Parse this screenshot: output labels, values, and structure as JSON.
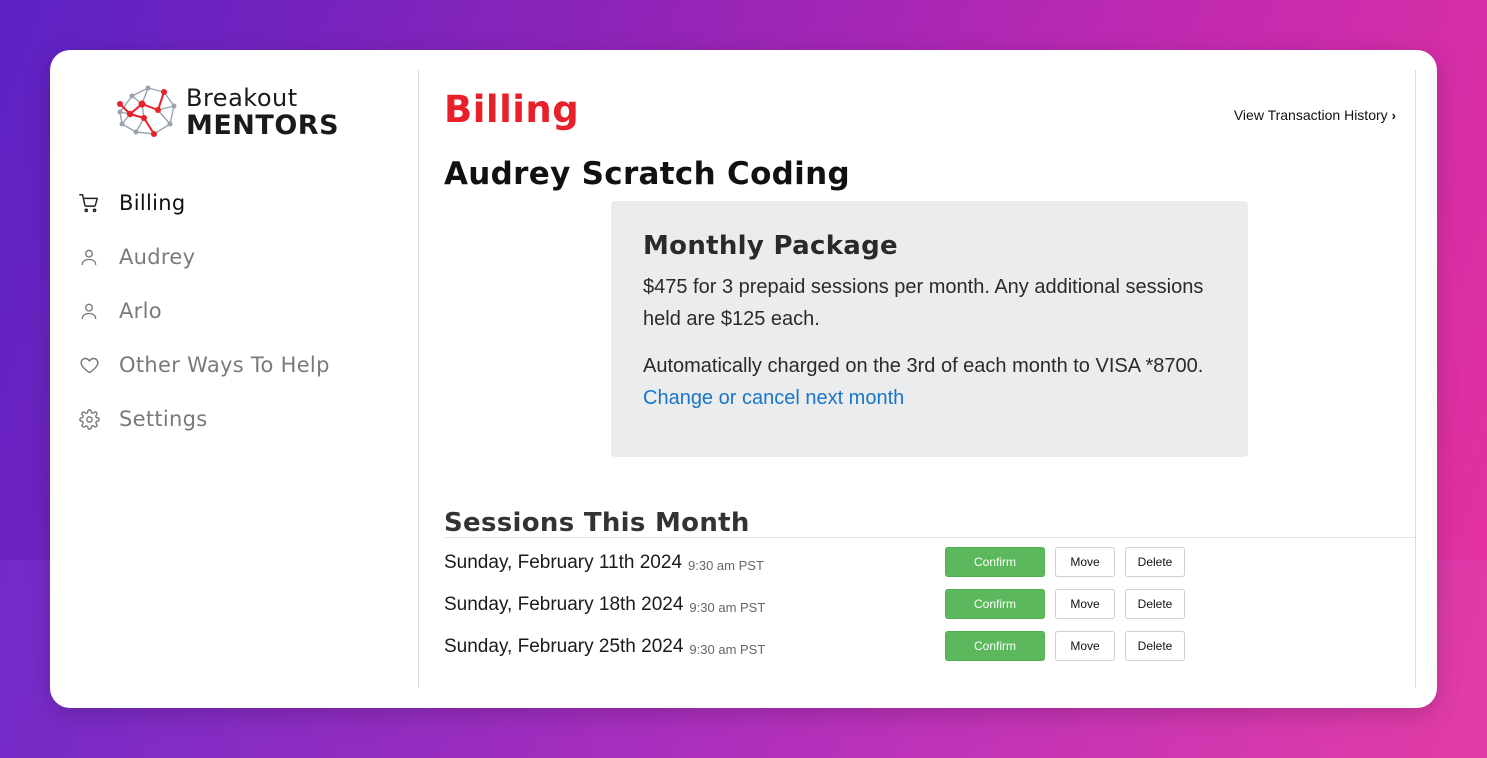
{
  "brand": {
    "line1": "Breakout",
    "line2": "MENTORS",
    "accent_color": "#e8202a",
    "node_color": "#9aa3ad"
  },
  "sidebar": {
    "items": [
      {
        "label": "Billing",
        "icon": "cart-icon",
        "active": true
      },
      {
        "label": "Audrey",
        "icon": "user-icon",
        "active": false
      },
      {
        "label": "Arlo",
        "icon": "user-icon",
        "active": false
      },
      {
        "label": "Other Ways To Help",
        "icon": "heart-icon",
        "active": false
      },
      {
        "label": "Settings",
        "icon": "gear-icon",
        "active": false
      }
    ]
  },
  "header": {
    "title": "Billing",
    "history_link": "View Transaction History"
  },
  "student": {
    "title": "Audrey Scratch Coding"
  },
  "package": {
    "title": "Monthly Package",
    "description": "$475 for 3 prepaid sessions per month. Any additional sessions held are $125 each.",
    "charge_text": "Automatically charged on the 3rd of each month to VISA *8700.",
    "change_link": "Change or cancel next month"
  },
  "sessions": {
    "title": "Sessions This Month",
    "confirm_label": "Confirm",
    "move_label": "Move",
    "delete_label": "Delete",
    "rows": [
      {
        "date": "Sunday, February 11th 2024",
        "time": "9:30 am PST"
      },
      {
        "date": "Sunday, February 18th 2024",
        "time": "9:30 am PST"
      },
      {
        "date": "Sunday, February 25th 2024",
        "time": "9:30 am PST"
      }
    ]
  },
  "colors": {
    "confirm": "#5cb85c",
    "link": "#1a75c9",
    "title_red": "#e8202a"
  }
}
